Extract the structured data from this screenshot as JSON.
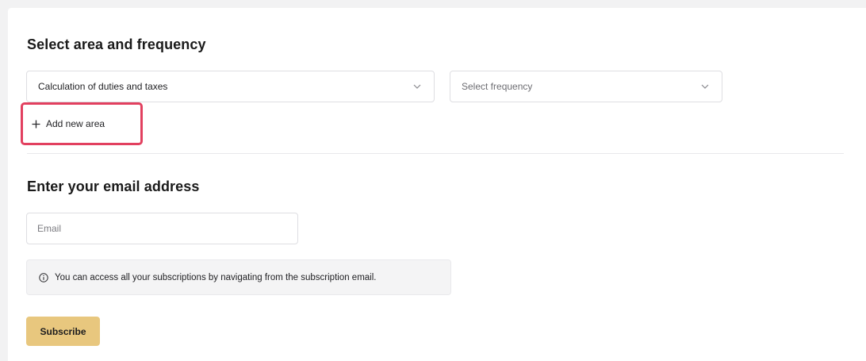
{
  "area_section": {
    "title": "Select area and frequency",
    "area_select_value": "Calculation of duties and taxes",
    "frequency_select_placeholder": "Select frequency",
    "add_area_label": "Add new area"
  },
  "email_section": {
    "title": "Enter your email address",
    "email_placeholder": "Email",
    "info_text": "You can access all your subscriptions by navigating from the subscription email."
  },
  "subscribe_label": "Subscribe",
  "colors": {
    "highlight_border": "#e2405f",
    "subscribe_button": "#e8c77e"
  },
  "icons": {
    "dropdown": "chevron-down-icon",
    "add": "plus-icon",
    "info": "info-circle-icon"
  }
}
